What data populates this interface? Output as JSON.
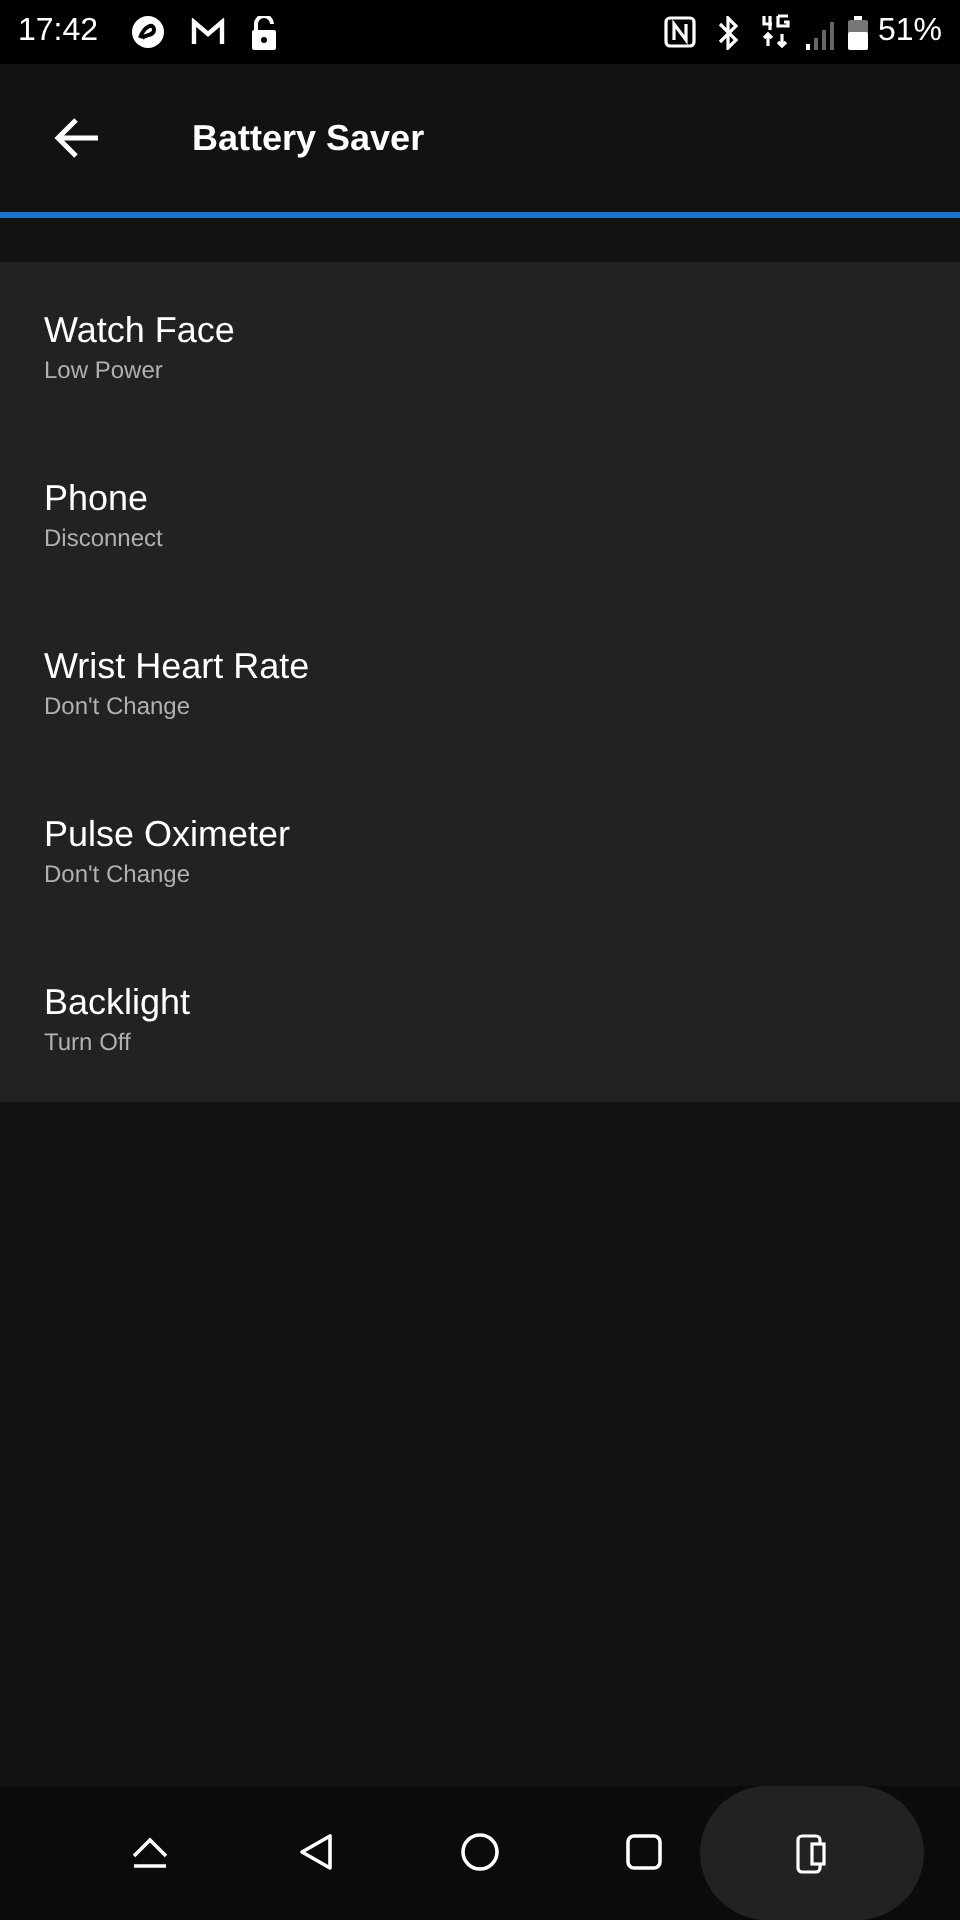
{
  "status_bar": {
    "time": "17:42",
    "battery": "51%"
  },
  "app_bar": {
    "title": "Battery Saver"
  },
  "settings": [
    {
      "title": "Watch Face",
      "value": "Low Power"
    },
    {
      "title": "Phone",
      "value": "Disconnect"
    },
    {
      "title": "Wrist Heart Rate",
      "value": "Don't Change"
    },
    {
      "title": "Pulse Oximeter",
      "value": "Don't Change"
    },
    {
      "title": "Backlight",
      "value": "Turn Off"
    }
  ]
}
